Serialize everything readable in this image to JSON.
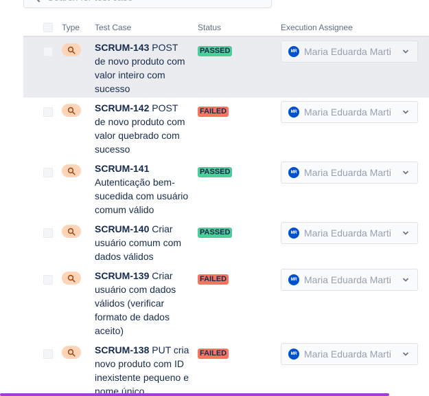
{
  "search": {
    "placeholder": "Search for test case"
  },
  "table": {
    "headers": {
      "type": "Type",
      "test_case": "Test Case",
      "status": "Status",
      "assignee": "Execution Assignee"
    },
    "rows": [
      {
        "key": "SCRUM-143",
        "title": "POST de novo produto com valor inteiro com sucesso",
        "status": "PASSED",
        "assignee_initials": "MR",
        "assignee": "Maria Eduarda Marti",
        "selected": true
      },
      {
        "key": "SCRUM-142",
        "title": "POST de novo produto com valor quebrado com sucesso",
        "status": "FAILED",
        "assignee_initials": "MR",
        "assignee": "Maria Eduarda Marti",
        "selected": false
      },
      {
        "key": "SCRUM-141",
        "title": "Autenticação bem-sucedida com usuário comum válido",
        "status": "PASSED",
        "assignee_initials": "MR",
        "assignee": "Maria Eduarda Marti",
        "selected": false
      },
      {
        "key": "SCRUM-140",
        "title": "Criar usuário comum com dados válidos",
        "status": "PASSED",
        "assignee_initials": "MR",
        "assignee": "Maria Eduarda Marti",
        "selected": false
      },
      {
        "key": "SCRUM-139",
        "title": "Criar usuário com dados válidos (verificar formato de dados aceito)",
        "status": "FAILED",
        "assignee_initials": "MR",
        "assignee": "Maria Eduarda Marti",
        "selected": false
      },
      {
        "key": "SCRUM-138",
        "title": "PUT cria novo produto com ID inexistente pequeno e nome único",
        "status": "FAILED",
        "assignee_initials": "MR",
        "assignee": "Maria Eduarda Marti",
        "selected": false
      }
    ]
  },
  "colors": {
    "passed": "#4bce97",
    "failed": "#f87462",
    "type_badge": "#ffd4b8",
    "avatar": "#0052cc",
    "selected_row": "#ebecf0",
    "bottom_bar": "#a23fd0"
  },
  "icons": {
    "search": "search-icon",
    "type": "magnifier-icon",
    "dropdown": "chevron-down-icon"
  }
}
